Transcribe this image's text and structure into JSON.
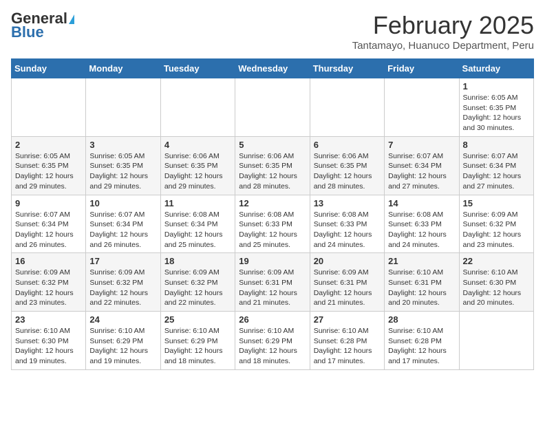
{
  "header": {
    "logo_general": "General",
    "logo_blue": "Blue",
    "month_title": "February 2025",
    "location": "Tantamayo, Huanuco Department, Peru"
  },
  "weekdays": [
    "Sunday",
    "Monday",
    "Tuesday",
    "Wednesday",
    "Thursday",
    "Friday",
    "Saturday"
  ],
  "weeks": [
    [
      {
        "day": "",
        "info": ""
      },
      {
        "day": "",
        "info": ""
      },
      {
        "day": "",
        "info": ""
      },
      {
        "day": "",
        "info": ""
      },
      {
        "day": "",
        "info": ""
      },
      {
        "day": "",
        "info": ""
      },
      {
        "day": "1",
        "info": "Sunrise: 6:05 AM\nSunset: 6:35 PM\nDaylight: 12 hours and 30 minutes."
      }
    ],
    [
      {
        "day": "2",
        "info": "Sunrise: 6:05 AM\nSunset: 6:35 PM\nDaylight: 12 hours and 29 minutes."
      },
      {
        "day": "3",
        "info": "Sunrise: 6:05 AM\nSunset: 6:35 PM\nDaylight: 12 hours and 29 minutes."
      },
      {
        "day": "4",
        "info": "Sunrise: 6:06 AM\nSunset: 6:35 PM\nDaylight: 12 hours and 29 minutes."
      },
      {
        "day": "5",
        "info": "Sunrise: 6:06 AM\nSunset: 6:35 PM\nDaylight: 12 hours and 28 minutes."
      },
      {
        "day": "6",
        "info": "Sunrise: 6:06 AM\nSunset: 6:35 PM\nDaylight: 12 hours and 28 minutes."
      },
      {
        "day": "7",
        "info": "Sunrise: 6:07 AM\nSunset: 6:34 PM\nDaylight: 12 hours and 27 minutes."
      },
      {
        "day": "8",
        "info": "Sunrise: 6:07 AM\nSunset: 6:34 PM\nDaylight: 12 hours and 27 minutes."
      }
    ],
    [
      {
        "day": "9",
        "info": "Sunrise: 6:07 AM\nSunset: 6:34 PM\nDaylight: 12 hours and 26 minutes."
      },
      {
        "day": "10",
        "info": "Sunrise: 6:07 AM\nSunset: 6:34 PM\nDaylight: 12 hours and 26 minutes."
      },
      {
        "day": "11",
        "info": "Sunrise: 6:08 AM\nSunset: 6:34 PM\nDaylight: 12 hours and 25 minutes."
      },
      {
        "day": "12",
        "info": "Sunrise: 6:08 AM\nSunset: 6:33 PM\nDaylight: 12 hours and 25 minutes."
      },
      {
        "day": "13",
        "info": "Sunrise: 6:08 AM\nSunset: 6:33 PM\nDaylight: 12 hours and 24 minutes."
      },
      {
        "day": "14",
        "info": "Sunrise: 6:08 AM\nSunset: 6:33 PM\nDaylight: 12 hours and 24 minutes."
      },
      {
        "day": "15",
        "info": "Sunrise: 6:09 AM\nSunset: 6:32 PM\nDaylight: 12 hours and 23 minutes."
      }
    ],
    [
      {
        "day": "16",
        "info": "Sunrise: 6:09 AM\nSunset: 6:32 PM\nDaylight: 12 hours and 23 minutes."
      },
      {
        "day": "17",
        "info": "Sunrise: 6:09 AM\nSunset: 6:32 PM\nDaylight: 12 hours and 22 minutes."
      },
      {
        "day": "18",
        "info": "Sunrise: 6:09 AM\nSunset: 6:32 PM\nDaylight: 12 hours and 22 minutes."
      },
      {
        "day": "19",
        "info": "Sunrise: 6:09 AM\nSunset: 6:31 PM\nDaylight: 12 hours and 21 minutes."
      },
      {
        "day": "20",
        "info": "Sunrise: 6:09 AM\nSunset: 6:31 PM\nDaylight: 12 hours and 21 minutes."
      },
      {
        "day": "21",
        "info": "Sunrise: 6:10 AM\nSunset: 6:31 PM\nDaylight: 12 hours and 20 minutes."
      },
      {
        "day": "22",
        "info": "Sunrise: 6:10 AM\nSunset: 6:30 PM\nDaylight: 12 hours and 20 minutes."
      }
    ],
    [
      {
        "day": "23",
        "info": "Sunrise: 6:10 AM\nSunset: 6:30 PM\nDaylight: 12 hours and 19 minutes."
      },
      {
        "day": "24",
        "info": "Sunrise: 6:10 AM\nSunset: 6:29 PM\nDaylight: 12 hours and 19 minutes."
      },
      {
        "day": "25",
        "info": "Sunrise: 6:10 AM\nSunset: 6:29 PM\nDaylight: 12 hours and 18 minutes."
      },
      {
        "day": "26",
        "info": "Sunrise: 6:10 AM\nSunset: 6:29 PM\nDaylight: 12 hours and 18 minutes."
      },
      {
        "day": "27",
        "info": "Sunrise: 6:10 AM\nSunset: 6:28 PM\nDaylight: 12 hours and 17 minutes."
      },
      {
        "day": "28",
        "info": "Sunrise: 6:10 AM\nSunset: 6:28 PM\nDaylight: 12 hours and 17 minutes."
      },
      {
        "day": "",
        "info": ""
      }
    ]
  ]
}
